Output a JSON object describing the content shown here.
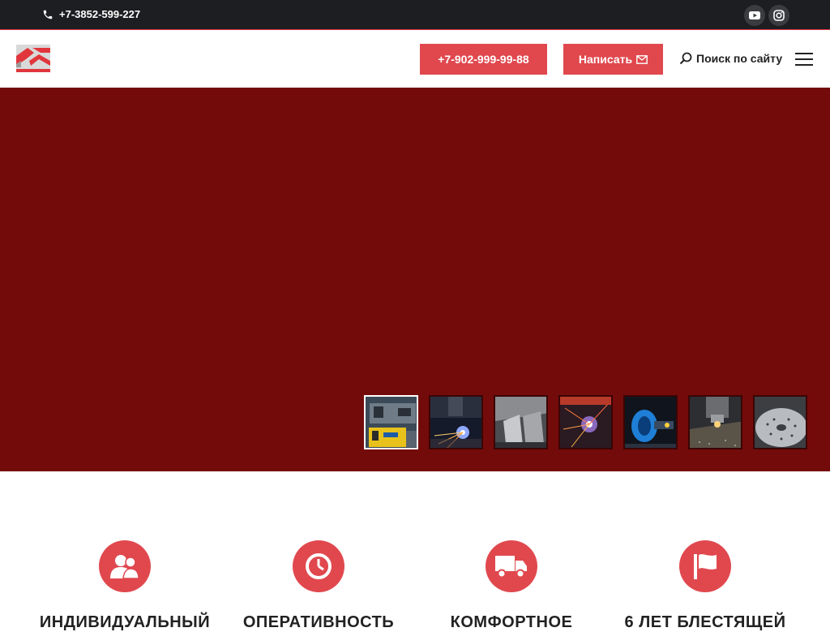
{
  "topbar": {
    "phone": "+7-3852-599-227",
    "social": [
      {
        "icon": "youtube-icon"
      },
      {
        "icon": "instagram-icon"
      }
    ]
  },
  "header": {
    "logo_icon": "company-logo",
    "phone_button": "+7-902-999-99-88",
    "write_button": "Написать",
    "search_label": "Поиск по сайту"
  },
  "hero": {
    "background_color": "#740b0b",
    "thumbnails": [
      {
        "name": "machine-yellow",
        "active": true
      },
      {
        "name": "plasma-cutting"
      },
      {
        "name": "bending-press"
      },
      {
        "name": "welding-sparks"
      },
      {
        "name": "blue-laser"
      },
      {
        "name": "drilling-head"
      },
      {
        "name": "perforated-disc"
      }
    ]
  },
  "features": [
    {
      "icon": "person-icon",
      "title": "ИНДИВИДУАЛЬНЫЙ"
    },
    {
      "icon": "clock-icon",
      "title": "ОПЕРАТИВНОСТЬ"
    },
    {
      "icon": "truck-icon",
      "title": "КОМФОРТНОЕ"
    },
    {
      "icon": "flag-icon",
      "title": "6 ЛЕТ БЛЕСТЯЩЕЙ"
    }
  ],
  "colors": {
    "accent": "#e0484e",
    "dark": "#1c1e21",
    "hero": "#740b0b"
  }
}
